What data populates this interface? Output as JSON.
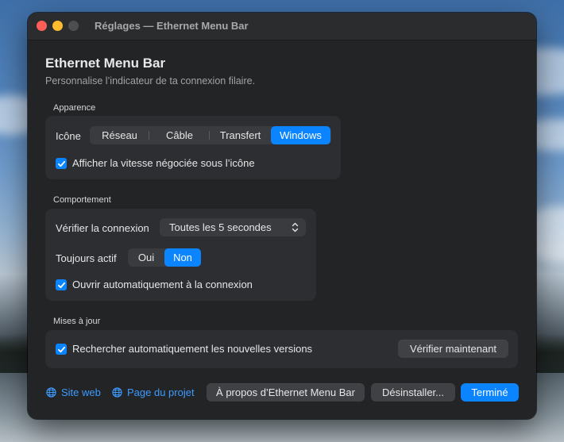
{
  "window": {
    "title": "Réglages — Ethernet Menu Bar"
  },
  "header": {
    "title": "Ethernet Menu Bar",
    "subtitle": "Personnalise l’indicateur de ta connexion filaire."
  },
  "appearance": {
    "section_label": "Apparence",
    "icon_label": "Icône",
    "icon_options": [
      "Réseau",
      "Câble",
      "Transfert",
      "Windows"
    ],
    "icon_selected": "Windows",
    "show_speed_label": "Afficher la vitesse négociée sous l’icône",
    "show_speed_checked": true
  },
  "behavior": {
    "section_label": "Comportement",
    "check_label": "Vérifier la connexion",
    "check_value": "Toutes les 5 secondes",
    "always_active_label": "Toujours actif",
    "always_active_options": [
      "Oui",
      "Non"
    ],
    "always_active_selected": "Non",
    "auto_open_label": "Ouvrir automatiquement à la connexion",
    "auto_open_checked": true
  },
  "updates": {
    "section_label": "Mises à jour",
    "auto_check_label": "Rechercher automatiquement les nouvelles versions",
    "auto_check_checked": true,
    "check_now_label": "Vérifier maintenant"
  },
  "footer": {
    "website_label": "Site web",
    "project_label": "Page du projet",
    "about_label": "À propos d’Ethernet Menu Bar",
    "uninstall_label": "Désinstaller...",
    "done_label": "Terminé"
  },
  "colors": {
    "accent": "#0a84ff",
    "window_bg": "#232426",
    "card_bg": "#2d2e31",
    "link": "#3d9bff"
  }
}
